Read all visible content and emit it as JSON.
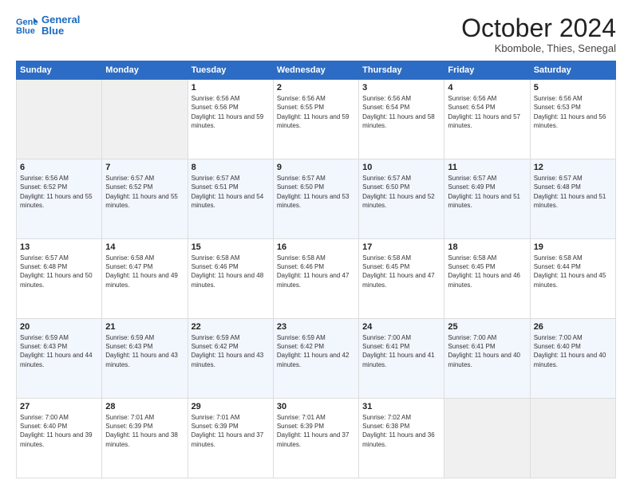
{
  "logo": {
    "line1": "General",
    "line2": "Blue"
  },
  "header": {
    "title": "October 2024",
    "location": "Kbombole, Thies, Senegal"
  },
  "weekdays": [
    "Sunday",
    "Monday",
    "Tuesday",
    "Wednesday",
    "Thursday",
    "Friday",
    "Saturday"
  ],
  "weeks": [
    [
      {
        "day": "",
        "content": ""
      },
      {
        "day": "",
        "content": ""
      },
      {
        "day": "1",
        "content": "Sunrise: 6:56 AM\nSunset: 6:56 PM\nDaylight: 11 hours and 59 minutes."
      },
      {
        "day": "2",
        "content": "Sunrise: 6:56 AM\nSunset: 6:55 PM\nDaylight: 11 hours and 59 minutes."
      },
      {
        "day": "3",
        "content": "Sunrise: 6:56 AM\nSunset: 6:54 PM\nDaylight: 11 hours and 58 minutes."
      },
      {
        "day": "4",
        "content": "Sunrise: 6:56 AM\nSunset: 6:54 PM\nDaylight: 11 hours and 57 minutes."
      },
      {
        "day": "5",
        "content": "Sunrise: 6:56 AM\nSunset: 6:53 PM\nDaylight: 11 hours and 56 minutes."
      }
    ],
    [
      {
        "day": "6",
        "content": "Sunrise: 6:56 AM\nSunset: 6:52 PM\nDaylight: 11 hours and 55 minutes."
      },
      {
        "day": "7",
        "content": "Sunrise: 6:57 AM\nSunset: 6:52 PM\nDaylight: 11 hours and 55 minutes."
      },
      {
        "day": "8",
        "content": "Sunrise: 6:57 AM\nSunset: 6:51 PM\nDaylight: 11 hours and 54 minutes."
      },
      {
        "day": "9",
        "content": "Sunrise: 6:57 AM\nSunset: 6:50 PM\nDaylight: 11 hours and 53 minutes."
      },
      {
        "day": "10",
        "content": "Sunrise: 6:57 AM\nSunset: 6:50 PM\nDaylight: 11 hours and 52 minutes."
      },
      {
        "day": "11",
        "content": "Sunrise: 6:57 AM\nSunset: 6:49 PM\nDaylight: 11 hours and 51 minutes."
      },
      {
        "day": "12",
        "content": "Sunrise: 6:57 AM\nSunset: 6:48 PM\nDaylight: 11 hours and 51 minutes."
      }
    ],
    [
      {
        "day": "13",
        "content": "Sunrise: 6:57 AM\nSunset: 6:48 PM\nDaylight: 11 hours and 50 minutes."
      },
      {
        "day": "14",
        "content": "Sunrise: 6:58 AM\nSunset: 6:47 PM\nDaylight: 11 hours and 49 minutes."
      },
      {
        "day": "15",
        "content": "Sunrise: 6:58 AM\nSunset: 6:46 PM\nDaylight: 11 hours and 48 minutes."
      },
      {
        "day": "16",
        "content": "Sunrise: 6:58 AM\nSunset: 6:46 PM\nDaylight: 11 hours and 47 minutes."
      },
      {
        "day": "17",
        "content": "Sunrise: 6:58 AM\nSunset: 6:45 PM\nDaylight: 11 hours and 47 minutes."
      },
      {
        "day": "18",
        "content": "Sunrise: 6:58 AM\nSunset: 6:45 PM\nDaylight: 11 hours and 46 minutes."
      },
      {
        "day": "19",
        "content": "Sunrise: 6:58 AM\nSunset: 6:44 PM\nDaylight: 11 hours and 45 minutes."
      }
    ],
    [
      {
        "day": "20",
        "content": "Sunrise: 6:59 AM\nSunset: 6:43 PM\nDaylight: 11 hours and 44 minutes."
      },
      {
        "day": "21",
        "content": "Sunrise: 6:59 AM\nSunset: 6:43 PM\nDaylight: 11 hours and 43 minutes."
      },
      {
        "day": "22",
        "content": "Sunrise: 6:59 AM\nSunset: 6:42 PM\nDaylight: 11 hours and 43 minutes."
      },
      {
        "day": "23",
        "content": "Sunrise: 6:59 AM\nSunset: 6:42 PM\nDaylight: 11 hours and 42 minutes."
      },
      {
        "day": "24",
        "content": "Sunrise: 7:00 AM\nSunset: 6:41 PM\nDaylight: 11 hours and 41 minutes."
      },
      {
        "day": "25",
        "content": "Sunrise: 7:00 AM\nSunset: 6:41 PM\nDaylight: 11 hours and 40 minutes."
      },
      {
        "day": "26",
        "content": "Sunrise: 7:00 AM\nSunset: 6:40 PM\nDaylight: 11 hours and 40 minutes."
      }
    ],
    [
      {
        "day": "27",
        "content": "Sunrise: 7:00 AM\nSunset: 6:40 PM\nDaylight: 11 hours and 39 minutes."
      },
      {
        "day": "28",
        "content": "Sunrise: 7:01 AM\nSunset: 6:39 PM\nDaylight: 11 hours and 38 minutes."
      },
      {
        "day": "29",
        "content": "Sunrise: 7:01 AM\nSunset: 6:39 PM\nDaylight: 11 hours and 37 minutes."
      },
      {
        "day": "30",
        "content": "Sunrise: 7:01 AM\nSunset: 6:39 PM\nDaylight: 11 hours and 37 minutes."
      },
      {
        "day": "31",
        "content": "Sunrise: 7:02 AM\nSunset: 6:38 PM\nDaylight: 11 hours and 36 minutes."
      },
      {
        "day": "",
        "content": ""
      },
      {
        "day": "",
        "content": ""
      }
    ]
  ]
}
